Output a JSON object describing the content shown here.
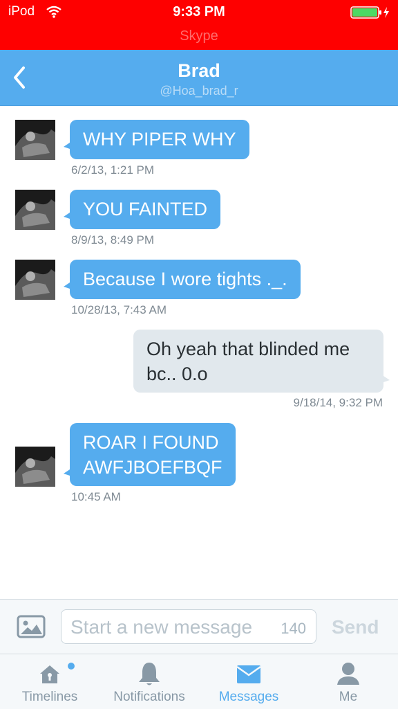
{
  "status_bar": {
    "carrier": "iPod",
    "time": "9:33 PM",
    "app_banner": "Skype"
  },
  "header": {
    "name": "Brad",
    "handle": "@Hoa_brad_r"
  },
  "messages": [
    {
      "direction": "in",
      "text": "WHY PIPER WHY",
      "timestamp": "6/2/13, 1:21 PM"
    },
    {
      "direction": "in",
      "text": "YOU FAINTED",
      "timestamp": "8/9/13, 8:49 PM"
    },
    {
      "direction": "in",
      "text": "Because I wore tights ._.",
      "timestamp": "10/28/13, 7:43 AM"
    },
    {
      "direction": "out",
      "text_lines": [
        "Oh yeah that blinded me",
        "bc.. 0.o"
      ],
      "timestamp": "9/18/14, 9:32 PM"
    },
    {
      "direction": "in",
      "text_lines": [
        "ROAR I FOUND",
        "AWFJBOEFBQF"
      ],
      "timestamp": "10:45 AM"
    }
  ],
  "compose": {
    "placeholder": "Start a new message",
    "char_count": "140",
    "send_label": "Send"
  },
  "tabs": [
    {
      "label": "Timelines",
      "icon": "home-icon"
    },
    {
      "label": "Notifications",
      "icon": "bell-icon"
    },
    {
      "label": "Messages",
      "icon": "envelope-icon"
    },
    {
      "label": "Me",
      "icon": "person-icon"
    }
  ],
  "active_tab": "Messages",
  "colors": {
    "status_bar": "#fe0000",
    "accent": "#55acee",
    "outgoing_bubble": "#e1e8ed",
    "inactive_tab": "#8899a6"
  }
}
